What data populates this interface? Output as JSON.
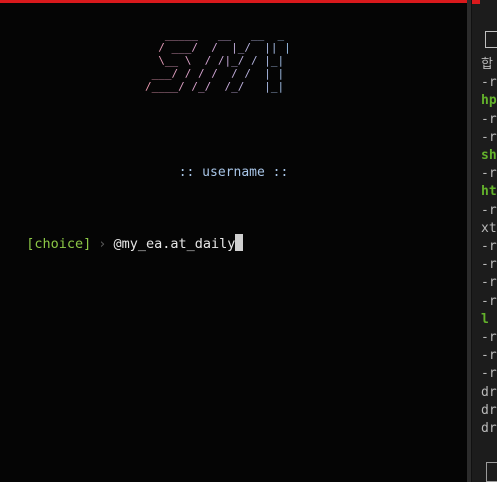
{
  "logo": {
    "text": "SMH",
    "art": [
      "   _____   __   __  _ ",
      "  / ___/  /  |_/  || |",
      "  \\__ \\  / /|_/ / |_|",
      " ___/ / / /  / /  | |",
      "/____/ /_/  /_/   |_|"
    ]
  },
  "main": {
    "username_label": ":: username ::",
    "prompt_tag": "[choice]",
    "prompt_arrow": "›",
    "input_value": "@my_ea.at_daily"
  },
  "side": {
    "lines": [
      {
        "text": "합",
        "green": false
      },
      {
        "text": "-r",
        "green": false
      },
      {
        "text": "hp",
        "green": true
      },
      {
        "text": "-r",
        "green": false
      },
      {
        "text": "-r",
        "green": false
      },
      {
        "text": "sh",
        "green": true
      },
      {
        "text": "-r",
        "green": false
      },
      {
        "text": "ht",
        "green": true
      },
      {
        "text": "-r",
        "green": false
      },
      {
        "text": "xt",
        "green": false
      },
      {
        "text": "-r",
        "green": false
      },
      {
        "text": "-r",
        "green": false
      },
      {
        "text": "-r",
        "green": false
      },
      {
        "text": "-r",
        "green": false
      },
      {
        "text": "l",
        "green": true
      },
      {
        "text": "-r",
        "green": false
      },
      {
        "text": "-r",
        "green": false
      },
      {
        "text": "-r",
        "green": false
      },
      {
        "text": "dr",
        "green": false
      },
      {
        "text": "dr",
        "green": false
      },
      {
        "text": "dr",
        "green": false
      }
    ]
  },
  "colors": {
    "accent_red": "#d9191c",
    "prompt_green": "#8cc846",
    "label_blue": "#a9c6e8",
    "side_green": "#63b22b"
  }
}
